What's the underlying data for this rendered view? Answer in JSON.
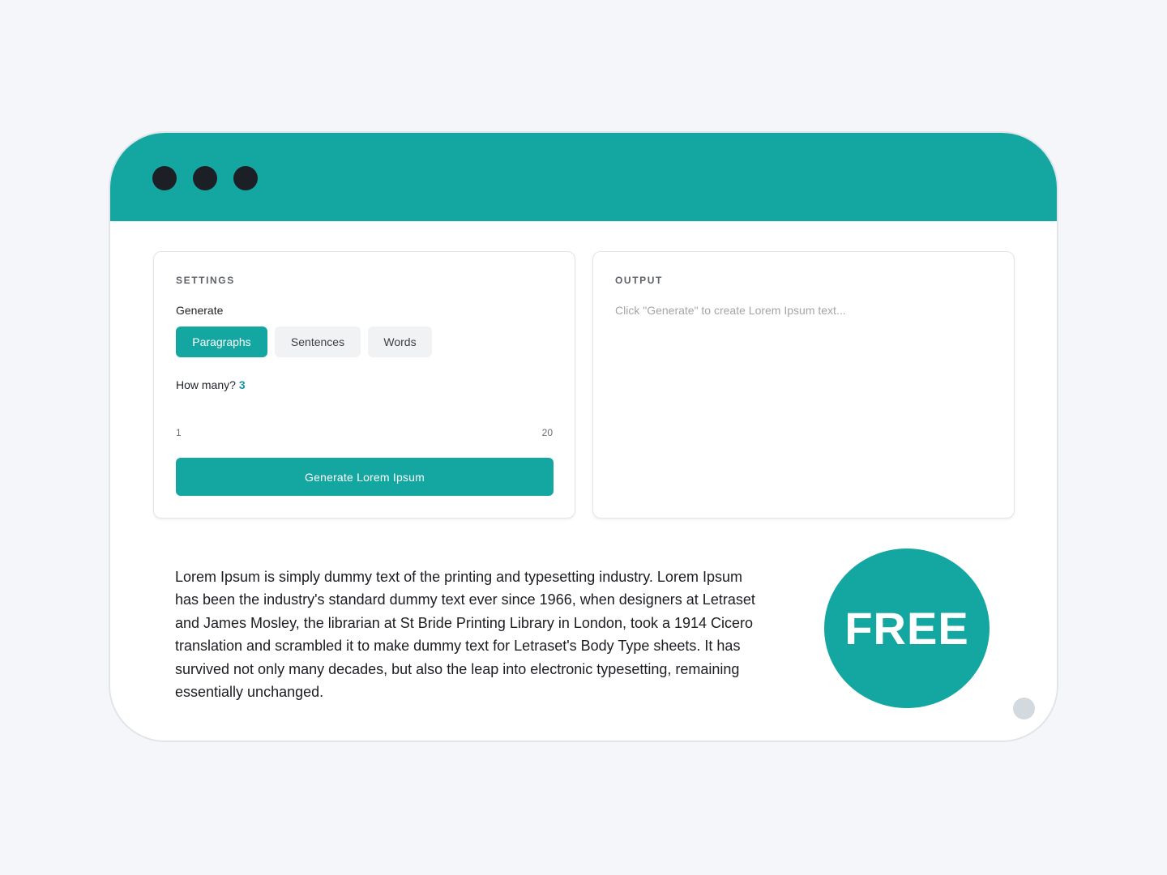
{
  "window": {
    "accent_color": "#14a6a0",
    "dots": [
      "window-dot",
      "window-dot",
      "window-dot"
    ]
  },
  "settings": {
    "heading": "SETTINGS",
    "generate_label": "Generate",
    "modes": [
      {
        "label": "Paragraphs",
        "selected": true
      },
      {
        "label": "Sentences",
        "selected": false
      },
      {
        "label": "Words",
        "selected": false
      }
    ],
    "how_many_label": "How many?",
    "how_many_value": "3",
    "range_min": "1",
    "range_max": "20",
    "generate_button": "Generate Lorem Ipsum"
  },
  "output": {
    "heading": "OUTPUT",
    "placeholder": "Click \"Generate\" to create Lorem Ipsum text..."
  },
  "description": "Lorem Ipsum is simply dummy text of the printing and typesetting industry. Lorem Ipsum has been the industry's standard dummy text ever since 1966, when designers at Letraset and James Mosley, the librarian at St Bride Printing Library in London, took a 1914 Cicero translation and scrambled it to make dummy text for Letraset's Body Type sheets. It has survived not only many decades, but also the leap into electronic typesetting, remaining essentially unchanged.",
  "badge": {
    "label": "FREE"
  }
}
